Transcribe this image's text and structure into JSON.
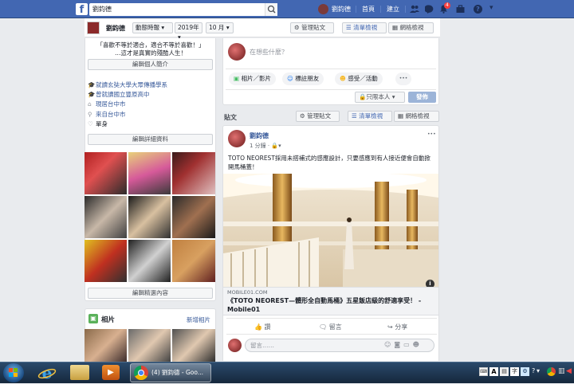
{
  "topbar": {
    "search_value": "劉鈞德",
    "user_name": "劉鈞德",
    "home_label": "首頁",
    "create_label": "建立",
    "notif_count": "4"
  },
  "subheader": {
    "name": "劉鈞德",
    "timeline_label": "動態時報",
    "year": "2019年",
    "month": "10 月",
    "manage_posts": "管理貼文",
    "list_view": "清單檢視",
    "grid_view": "網格檢視"
  },
  "intro": {
    "bio_line1": "「喜歡不等於適合，適合不等於喜歡！」",
    "bio_line2": "…這才是真實的殘酷人生！",
    "edit_intro": "編輯個人簡介",
    "study": "就讀玄奘大學大眾傳播學系",
    "school": "曾就讀國立豐原高中",
    "live": "現居台中市",
    "from": "來自台中市",
    "relationship": "單身",
    "edit_details": "編輯詳細資料",
    "edit_featured": "編輯精選內容"
  },
  "photos_card": {
    "title": "相片",
    "add_photos": "新增相片"
  },
  "composer": {
    "placeholder": "在想些什麼？",
    "photo_video": "相片／影片",
    "tag_friends": "標註朋友",
    "feeling": "感受／活動",
    "more": "•••",
    "privacy": "只限本人",
    "publish": "發佈"
  },
  "posts_section": {
    "label": "貼文",
    "manage_posts": "管理貼文",
    "list_view": "清單檢視",
    "grid_view": "網格檢視"
  },
  "post": {
    "author": "劉鈞德",
    "time": "1 分鐘",
    "text": "TOTO NEOREST採用未搭補式的感應設計，只要感應到有人接近便會自動掀開馬桶蓋！",
    "link_domain": "MOBILE01.COM",
    "link_title": "《TOTO NEOREST—體形全自動馬桶》五星飯店級的舒適享受！ - Mobile01",
    "like": "讚",
    "comment": "留言",
    "share": "分享",
    "comment_placeholder": "留言……",
    "menu": "•••"
  },
  "taskbar": {
    "chrome_tab": "(4) 劉鈞德 - Goo..."
  },
  "colors": {
    "fb_blue": "#4267b2",
    "link_blue": "#365899",
    "publish_blue": "#9cb4d8"
  }
}
